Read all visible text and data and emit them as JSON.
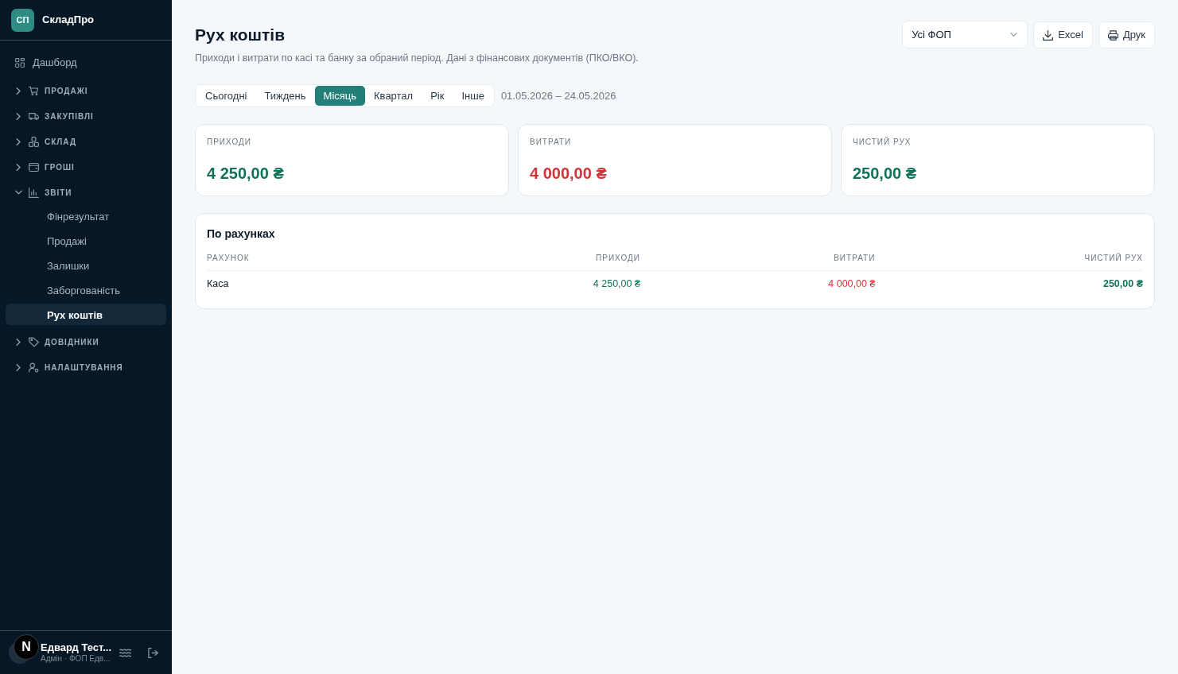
{
  "sidebar": {
    "brand": {
      "logo": "СП",
      "name": "СкладПро"
    },
    "items": [
      {
        "kind": "link",
        "label": "Дашборд",
        "selected": false
      },
      {
        "kind": "group",
        "label": "ПРОДАЖІ",
        "expanded": false
      },
      {
        "kind": "group",
        "label": "ЗАКУПІВЛІ",
        "expanded": false
      },
      {
        "kind": "group",
        "label": "СКЛАД",
        "expanded": false
      },
      {
        "kind": "group",
        "label": "ГРОШІ",
        "expanded": false
      },
      {
        "kind": "group",
        "label": "ЗВІТИ",
        "expanded": true,
        "children": [
          {
            "label": "Фінрезультат",
            "selected": false
          },
          {
            "label": "Продажі",
            "selected": false
          },
          {
            "label": "Залишки",
            "selected": false
          },
          {
            "label": "Заборгованість",
            "selected": false
          },
          {
            "label": "Рух коштів",
            "selected": true
          }
        ]
      },
      {
        "kind": "group",
        "label": "ДОВІДНИКИ",
        "expanded": false
      },
      {
        "kind": "group",
        "label": "НАЛАШТУВАННЯ",
        "expanded": false
      }
    ],
    "user": {
      "name": "Едвард Тест...",
      "role": "Адмін · ФОП Едв..."
    }
  },
  "dev_badge": {
    "label": "N"
  },
  "header": {
    "title": "Рух коштів",
    "subtitle": "Приходи і витрати по касі та банку за обраний період. Дані з фінансових документів (ПКО/ВКО).",
    "filter": {
      "value": "Усі ФОП"
    },
    "buttons": [
      "Excel",
      "Друк"
    ]
  },
  "period": {
    "tabs": [
      {
        "label": "Сьогодні",
        "selected": false
      },
      {
        "label": "Тиждень",
        "selected": false
      },
      {
        "label": "Місяць",
        "selected": true
      },
      {
        "label": "Квартал",
        "selected": false
      },
      {
        "label": "Рік",
        "selected": false
      },
      {
        "label": "Інше",
        "selected": false
      }
    ],
    "range": "01.05.2026 – 24.05.2026"
  },
  "summary_cards": [
    {
      "label": "ПРИХОДИ",
      "value": "4 250,00 ₴",
      "color": "#0e7358"
    },
    {
      "label": "ВИТРАТИ",
      "value": "4 000,00 ₴",
      "color": "#d13438"
    },
    {
      "label": "ЧИСТИЙ РУХ",
      "value": "250,00 ₴",
      "color": "#0e7358"
    }
  ],
  "accounts_table": {
    "title": "По рахунках",
    "columns": [
      "РАХУНОК",
      "ПРИХОДИ",
      "ВИТРАТИ",
      "ЧИСТИЙ РУХ"
    ],
    "rows": [
      {
        "cells": [
          {
            "text": "Каса"
          },
          {
            "text": "4 250,00 ₴",
            "color": "#0e7358"
          },
          {
            "text": "4 000,00 ₴",
            "color": "#d13438"
          },
          {
            "text": "250,00 ₴",
            "color": "#0e7358"
          }
        ]
      }
    ]
  }
}
